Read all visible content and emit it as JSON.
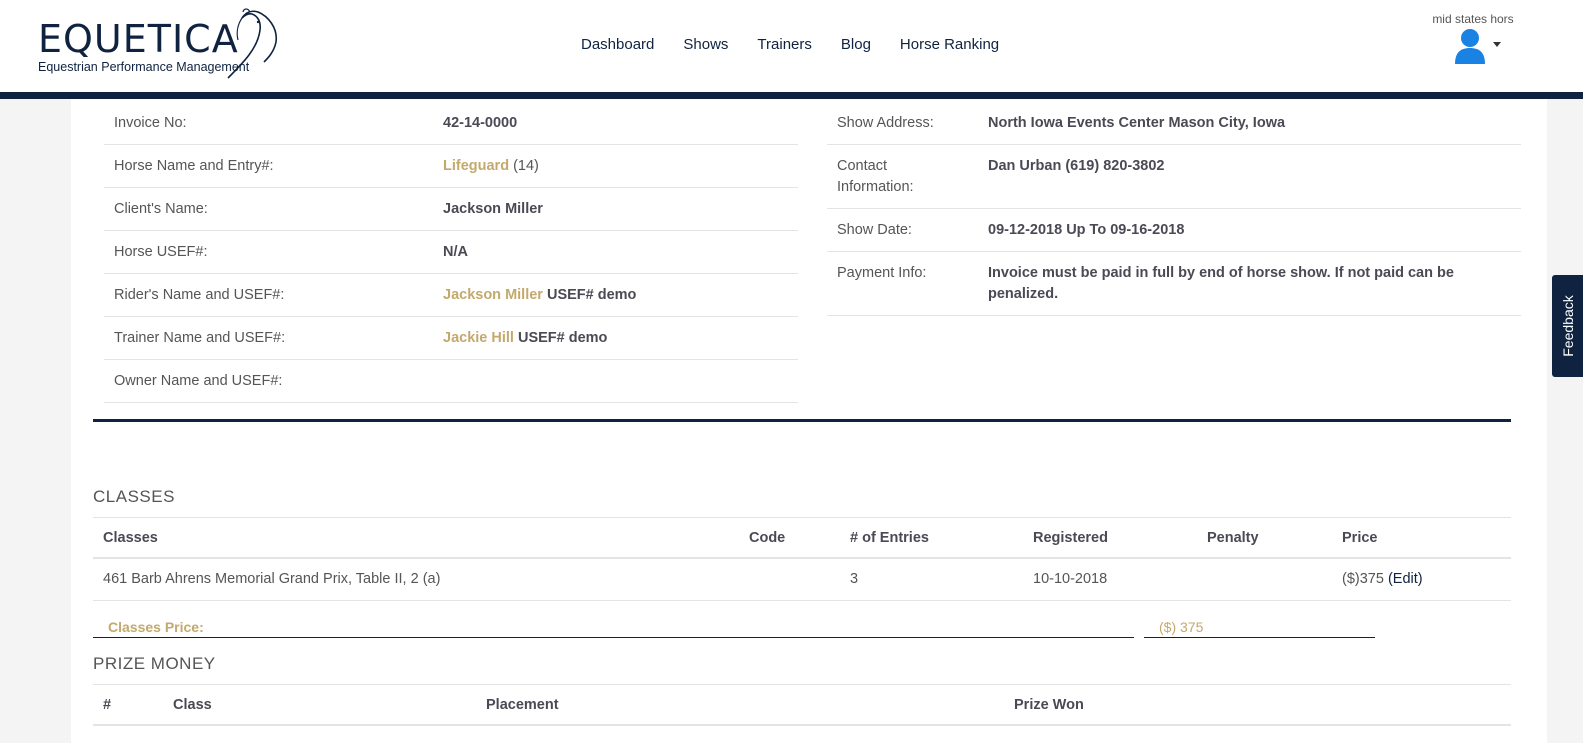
{
  "header": {
    "logo_text": "EQUETICA",
    "logo_subtitle": "Equestrian Performance Management",
    "nav": [
      "Dashboard",
      "Shows",
      "Trainers",
      "Blog",
      "Horse Ranking"
    ],
    "user_name": "mid states hors"
  },
  "invoice_left": {
    "invoice_no_label": "Invoice No:",
    "invoice_no": "42-14-0000",
    "horse_label": "Horse Name and Entry#:",
    "horse_name": "Lifeguard",
    "horse_entry": "(14)",
    "client_label": "Client's Name:",
    "client_name": "Jackson Miller",
    "horse_usef_label": "Horse USEF#:",
    "horse_usef": "N/A",
    "rider_label": "Rider's Name and USEF#:",
    "rider_name": "Jackson Miller",
    "rider_usef": "USEF# demo",
    "trainer_label": "Trainer Name and USEF#:",
    "trainer_name": "Jackie Hill",
    "trainer_usef": "USEF# demo",
    "owner_label": "Owner Name and USEF#:"
  },
  "invoice_right": {
    "address_label": "Show Address:",
    "address": "North Iowa Events Center Mason City, Iowa",
    "contact_label": "Contact Information:",
    "contact": "Dan Urban (619) 820-3802",
    "date_label": "Show Date:",
    "date": "09-12-2018 Up To 09-16-2018",
    "payment_label": "Payment Info:",
    "payment": "Invoice must be paid in full by end of horse show. If not paid can be penalized."
  },
  "classes": {
    "title": "CLASSES",
    "headers": [
      "Classes",
      "Code",
      "# of Entries",
      "Registered",
      "Penalty",
      "Price"
    ],
    "rows": [
      {
        "class": "461 Barb Ahrens Memorial Grand Prix, Table II, 2 (a)",
        "code": "",
        "entries": "3",
        "registered": "10-10-2018",
        "penalty": "",
        "price": "($)375",
        "edit": "(Edit)"
      }
    ],
    "total_label": "Classes Price:",
    "total_value": "($) 375"
  },
  "prize_money": {
    "title": "PRIZE MONEY",
    "headers": [
      "#",
      "Class",
      "Placement",
      "Prize Won"
    ]
  },
  "feedback_label": "Feedback",
  "colors": {
    "navy": "#0f2340",
    "gold": "#c4a96d",
    "avatar_blue": "#1a82e2"
  }
}
